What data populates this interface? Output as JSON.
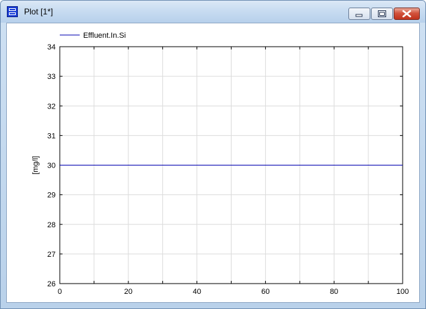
{
  "window": {
    "title": "Plot [1*]",
    "title_icon": "plot-window-icon",
    "buttons": [
      "minimize-icon",
      "maximize-icon",
      "close-icon"
    ]
  },
  "colors": {
    "series_line": "#0000b0",
    "grid": "#dcdcdc",
    "axis": "#000000",
    "close_button": "#c0321c"
  },
  "chart_data": {
    "type": "line",
    "title": "",
    "xlabel": "",
    "ylabel": "[mg/l]",
    "xlim": [
      0,
      100
    ],
    "ylim": [
      26,
      34
    ],
    "x_ticks": [
      "0",
      "20",
      "40",
      "60",
      "80",
      "100"
    ],
    "y_ticks": [
      "26",
      "27",
      "28",
      "29",
      "30",
      "31",
      "32",
      "33",
      "34"
    ],
    "grid": true,
    "legend_position": "top-left",
    "series": [
      {
        "name": "Effluent.In.Si",
        "x": [
          0,
          100
        ],
        "y": [
          30,
          30
        ]
      }
    ]
  }
}
